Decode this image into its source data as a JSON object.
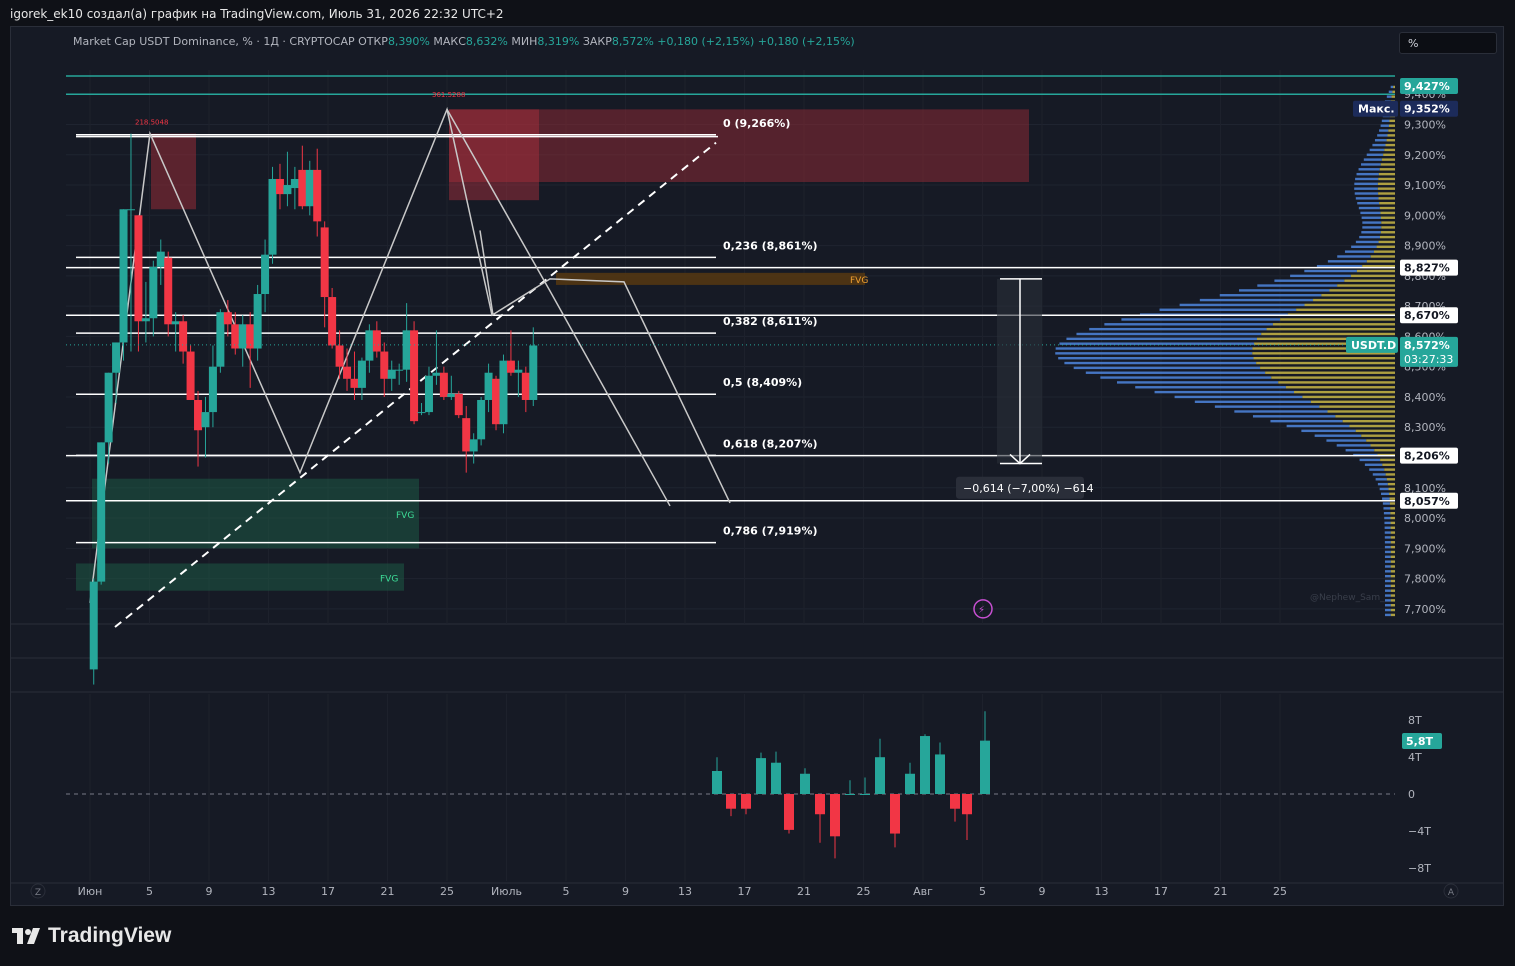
{
  "caption": "igorek_ek10 создал(а) график на TradingView.com, Июль 31, 2026 22:32 UTC+2",
  "legend": {
    "symbol": "Market Cap USDT Dominance, % · 1Д · CRYPTOCAP",
    "open_label": "ОТКР",
    "open": "8,390%",
    "high_label": "МАКС",
    "high": "8,632%",
    "low_label": "МИН",
    "low": "8,319%",
    "close_label": "ЗАКР",
    "close": "8,572%",
    "change": "+0,180 (+2,15%)",
    "change2": "+0,180 (+2,15%)"
  },
  "unit_box": "%",
  "logo_text": "TradingView",
  "watermark": "@Nephew_Sam_",
  "colors": {
    "up": "#26a69a",
    "down": "#f23645",
    "bg": "#161a25",
    "vp_blue": "#4a7fd4",
    "vp_yellow": "#b5a642",
    "fvg_green": "#1e5a45",
    "fvg_red": "#8a2a35",
    "fvg_orange": "#5a3a10"
  },
  "chart_data": {
    "type": "candlestick",
    "title": "Market Cap USDT Dominance, % · 1Д · CRYPTOCAP",
    "x_ticks": [
      "Июн",
      "5",
      "9",
      "13",
      "17",
      "21",
      "25",
      "Июль",
      "5",
      "9",
      "13",
      "17",
      "21",
      "25",
      "Авг",
      "5",
      "9",
      "13",
      "17",
      "21",
      "25"
    ],
    "y_ticks": [
      "7,700%",
      "7,800%",
      "7,900%",
      "8,000%",
      "8,100%",
      "8,200%",
      "8,300%",
      "8,400%",
      "8,500%",
      "8,600%",
      "8,700%",
      "8,800%",
      "8,900%",
      "9,000%",
      "9,100%",
      "9,200%",
      "9,300%",
      "9,400%"
    ],
    "y_range": [
      7.65,
      9.48
    ],
    "candles": [
      [
        1.0,
        7.5,
        7.8,
        7.45,
        7.79
      ],
      [
        3.0,
        7.79,
        8.25,
        7.78,
        8.25
      ],
      [
        5.0,
        8.25,
        8.48,
        8.18,
        8.48
      ],
      [
        7.0,
        8.48,
        8.58,
        8.38,
        8.58
      ],
      [
        9.0,
        8.58,
        9.02,
        8.52,
        9.02
      ],
      [
        11.0,
        9.02,
        9.27,
        8.55,
        9.02
      ],
      [
        13.0,
        9.0,
        9.0,
        8.55,
        8.65
      ],
      [
        15.0,
        8.65,
        8.78,
        8.58,
        8.66
      ],
      [
        17.0,
        8.66,
        8.85,
        8.6,
        8.83
      ],
      [
        19.0,
        8.83,
        8.92,
        8.77,
        8.88
      ],
      [
        21.0,
        8.86,
        8.88,
        8.6,
        8.64
      ],
      [
        23.0,
        8.64,
        8.68,
        8.55,
        8.65
      ],
      [
        25.0,
        8.65,
        8.67,
        8.51,
        8.55
      ],
      [
        27.0,
        8.55,
        8.57,
        8.39,
        8.39
      ],
      [
        29.0,
        8.39,
        8.42,
        8.17,
        8.29
      ],
      [
        31.0,
        8.3,
        8.4,
        8.2,
        8.35
      ],
      [
        33.0,
        8.35,
        8.57,
        8.3,
        8.5
      ],
      [
        35.0,
        8.5,
        8.69,
        8.48,
        8.68
      ],
      [
        37.0,
        8.68,
        8.72,
        8.6,
        8.64
      ],
      [
        39.0,
        8.64,
        8.68,
        8.54,
        8.56
      ],
      [
        41.0,
        8.56,
        8.67,
        8.5,
        8.64
      ],
      [
        43.0,
        8.64,
        8.68,
        8.43,
        8.56
      ],
      [
        45.0,
        8.56,
        8.77,
        8.52,
        8.74
      ],
      [
        47.0,
        8.74,
        8.92,
        8.68,
        8.87
      ],
      [
        49.0,
        8.87,
        9.16,
        8.84,
        9.12
      ],
      [
        51.0,
        9.12,
        9.17,
        9.02,
        9.07
      ],
      [
        53.0,
        9.07,
        9.21,
        9.03,
        9.1
      ],
      [
        55.0,
        9.09,
        9.16,
        9.02,
        9.12
      ],
      [
        57.0,
        9.15,
        9.23,
        9.02,
        9.03
      ],
      [
        59.0,
        9.03,
        9.18,
        9.0,
        9.15
      ],
      [
        61.0,
        9.15,
        9.22,
        8.93,
        8.98
      ],
      [
        63.0,
        8.96,
        8.98,
        8.63,
        8.73
      ],
      [
        65.0,
        8.73,
        8.76,
        8.56,
        8.57
      ],
      [
        67.0,
        8.57,
        8.62,
        8.46,
        8.5
      ],
      [
        69.0,
        8.5,
        8.56,
        8.42,
        8.46
      ],
      [
        71.0,
        8.46,
        8.55,
        8.39,
        8.43
      ],
      [
        73.0,
        8.43,
        8.53,
        8.39,
        8.52
      ],
      [
        75.0,
        8.52,
        8.64,
        8.48,
        8.62
      ],
      [
        77.0,
        8.62,
        8.65,
        8.53,
        8.55
      ],
      [
        79.0,
        8.55,
        8.58,
        8.4,
        8.46
      ],
      [
        81.0,
        8.46,
        8.52,
        8.42,
        8.49
      ],
      [
        83.0,
        8.49,
        8.51,
        8.44,
        8.49
      ],
      [
        85.0,
        8.49,
        8.71,
        8.45,
        8.62
      ],
      [
        87.0,
        8.62,
        8.65,
        8.31,
        8.32
      ],
      [
        89.0,
        8.35,
        8.38,
        8.34,
        8.35
      ],
      [
        91.0,
        8.35,
        8.5,
        8.34,
        8.47
      ],
      [
        93.0,
        8.47,
        8.62,
        8.44,
        8.48
      ],
      [
        95.0,
        8.48,
        8.5,
        8.39,
        8.4
      ],
      [
        97.0,
        8.4,
        8.47,
        8.39,
        8.41
      ],
      [
        99.0,
        8.41,
        8.42,
        8.33,
        8.34
      ],
      [
        101.0,
        8.33,
        8.37,
        8.15,
        8.22
      ],
      [
        103.0,
        8.22,
        8.28,
        8.18,
        8.26
      ],
      [
        105.0,
        8.26,
        8.4,
        8.24,
        8.39
      ],
      [
        107.0,
        8.39,
        8.51,
        8.35,
        8.48
      ],
      [
        109.0,
        8.46,
        8.47,
        8.29,
        8.31
      ],
      [
        111.0,
        8.31,
        8.54,
        8.28,
        8.52
      ],
      [
        113.0,
        8.52,
        8.62,
        8.47,
        8.48
      ],
      [
        115.0,
        8.48,
        8.52,
        8.4,
        8.49
      ],
      [
        117.0,
        8.48,
        8.5,
        8.35,
        8.39
      ],
      [
        119.0,
        8.39,
        8.63,
        8.37,
        8.57
      ]
    ],
    "volume_ticks": [
      "8T",
      "4T",
      "0",
      "−4T",
      "−8T"
    ],
    "fib_levels": [
      {
        "label": "0 (9,266%)",
        "value": 9.266
      },
      {
        "label": "0,236 (8,861%)",
        "value": 8.861
      },
      {
        "label": "0,382 (8,611%)",
        "value": 8.611
      },
      {
        "label": "0,5 (8,409%)",
        "value": 8.409
      },
      {
        "label": "0,618 (8,207%)",
        "value": 8.207
      },
      {
        "label": "0,786 (7,919%)",
        "value": 7.919
      }
    ],
    "price_tags": [
      {
        "text": "9,427%",
        "value": 9.427,
        "style": "teal"
      },
      {
        "text": "9,352%",
        "value": 9.352,
        "style": "navy",
        "prefix": "Макс."
      },
      {
        "text": "8,827%",
        "value": 8.827,
        "style": "white"
      },
      {
        "text": "8,670%",
        "value": 8.67,
        "style": "white"
      },
      {
        "text": "8,572%",
        "value": 8.572,
        "style": "teal",
        "prefix": "USDT.D",
        "sub": "03:27:33"
      },
      {
        "text": "8,206%",
        "value": 8.206,
        "style": "white"
      },
      {
        "text": "8,057%",
        "value": 8.057,
        "style": "white"
      }
    ],
    "volume_tag": "5,8T",
    "measure_label": "−0,614 (−7,00%) −614",
    "fvg_labels": [
      "FVG",
      "FVG",
      "FVG"
    ],
    "pivot_labels": [
      "218.5048",
      "361.5288"
    ]
  }
}
